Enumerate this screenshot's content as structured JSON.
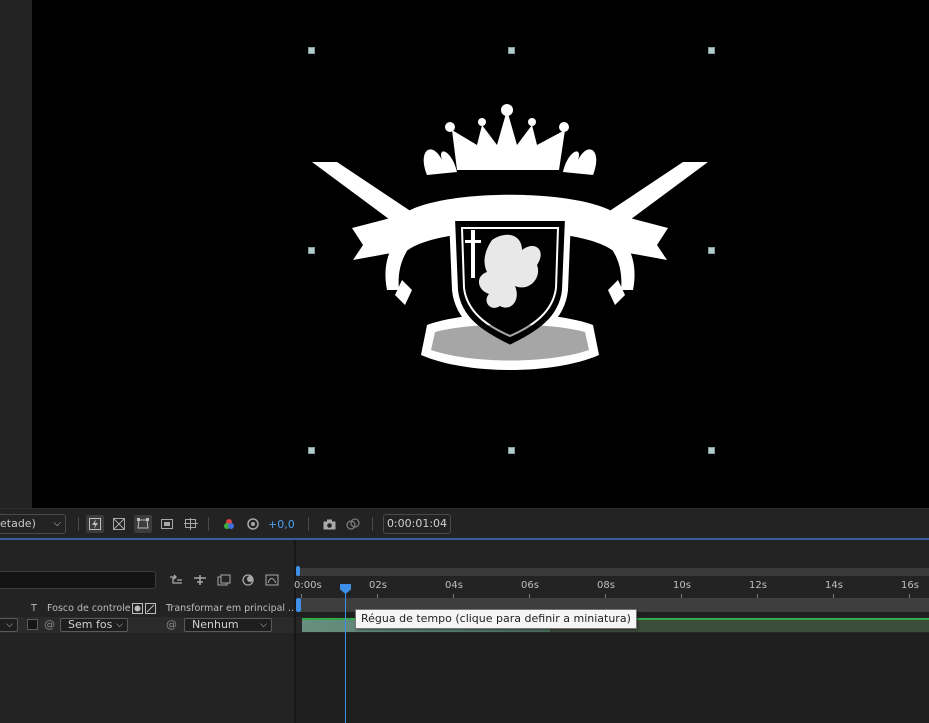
{
  "viewer": {
    "resolution_dropdown": "etade)"
  },
  "toolbar": {
    "exposure_value": "+0,0",
    "current_time": "0:00:01:04",
    "icons": [
      "fast-previews-icon",
      "transparency-grid-icon",
      "mask-visibility-icon",
      "region-of-interest-icon",
      "guides-icon",
      "channel-icon",
      "reset-exposure-icon",
      "snapshot-icon",
      "show-snapshot-icon"
    ]
  },
  "timeline": {
    "columns": {
      "t": "T",
      "track_matte": "Fosco de controle",
      "parent": "Transformar em principal ..."
    },
    "layer": {
      "matte_value": "Sem fos",
      "parent_value": "Nenhum"
    },
    "ruler_labels": [
      "0:00s",
      "02s",
      "04s",
      "06s",
      "08s",
      "10s",
      "12s",
      "14s",
      "16s"
    ],
    "tooltip": "Régua de tempo (clique para definir a miniatura)"
  },
  "colors": {
    "accent_blue": "#3d8ee6",
    "layer_green": "#31a84a",
    "viewer_bg": "#000000",
    "panel_bg": "#232323"
  }
}
